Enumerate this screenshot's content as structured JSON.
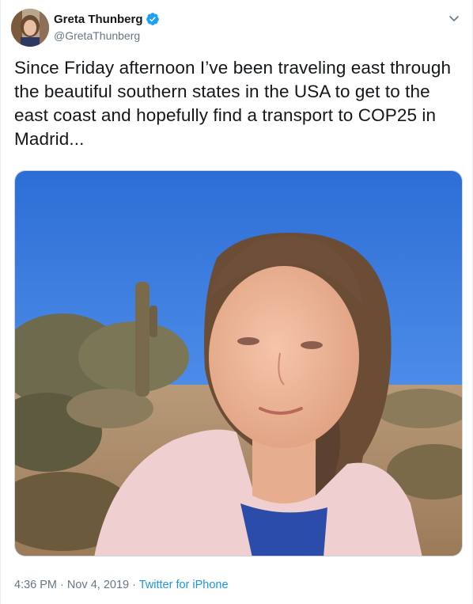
{
  "author": {
    "display_name": "Greta Thunberg",
    "handle": "@GretaThunberg",
    "verified": true,
    "verified_color": "#1da1f2"
  },
  "tweet": {
    "text": "Since Friday afternoon I’ve been traveling east through the beautiful southern states in the USA to get to the east coast and hopefully find a transport to COP25 in Madrid..."
  },
  "meta": {
    "time": "4:36 PM",
    "separator": " · ",
    "date": "Nov 4, 2019",
    "source": "Twitter for iPhone"
  },
  "icons": {
    "verified": "verified-badge-icon",
    "menu": "chevron-down-icon"
  }
}
